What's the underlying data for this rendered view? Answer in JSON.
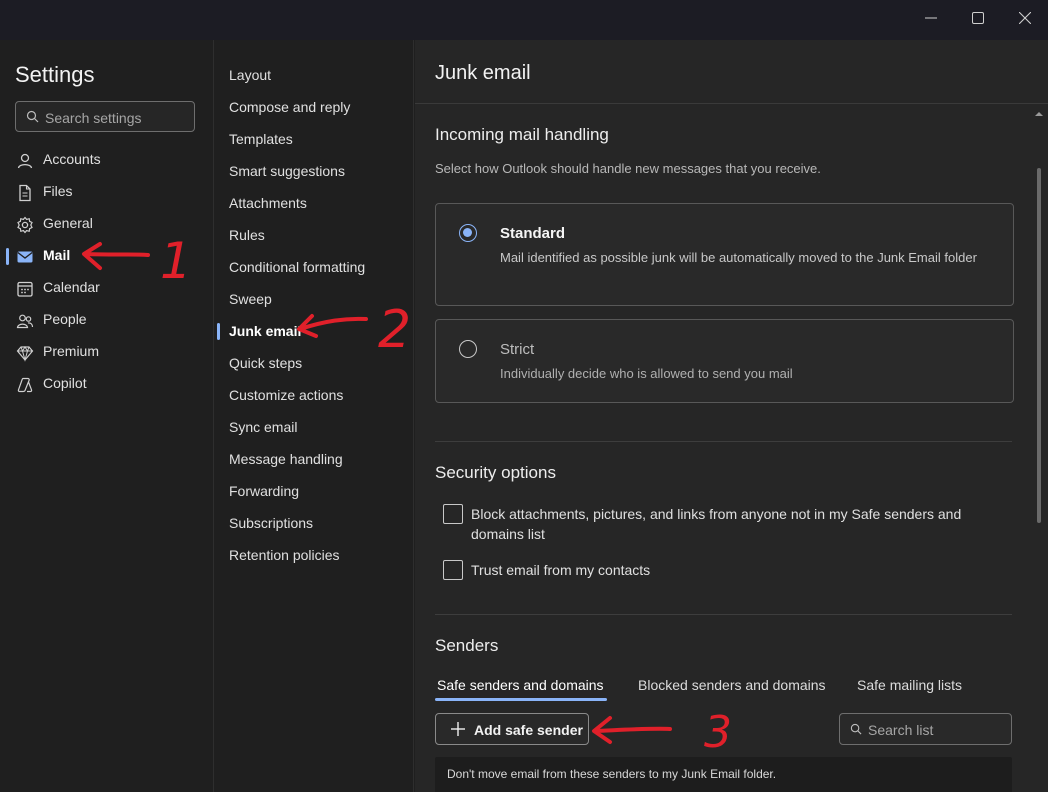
{
  "window_controls": {
    "minimize": "—",
    "maximize": "▢",
    "close": "✕"
  },
  "settings_nav": {
    "title": "Settings",
    "search_placeholder": "Search settings",
    "items": [
      {
        "label": "Accounts",
        "icon": "person-icon",
        "active": false
      },
      {
        "label": "Files",
        "icon": "file-icon",
        "active": false
      },
      {
        "label": "General",
        "icon": "gear-icon",
        "active": false
      },
      {
        "label": "Mail",
        "icon": "mail-icon",
        "active": true
      },
      {
        "label": "Calendar",
        "icon": "calendar-icon",
        "active": false
      },
      {
        "label": "People",
        "icon": "people-icon",
        "active": false
      },
      {
        "label": "Premium",
        "icon": "diamond-icon",
        "active": false
      },
      {
        "label": "Copilot",
        "icon": "copilot-icon",
        "active": false
      }
    ]
  },
  "mail_nav": {
    "items": [
      {
        "label": "Layout"
      },
      {
        "label": "Compose and reply"
      },
      {
        "label": "Templates"
      },
      {
        "label": "Smart suggestions"
      },
      {
        "label": "Attachments"
      },
      {
        "label": "Rules"
      },
      {
        "label": "Conditional formatting"
      },
      {
        "label": "Sweep"
      },
      {
        "label": "Junk email"
      },
      {
        "label": "Quick steps"
      },
      {
        "label": "Customize actions"
      },
      {
        "label": "Sync email"
      },
      {
        "label": "Message handling"
      },
      {
        "label": "Forwarding"
      },
      {
        "label": "Subscriptions"
      },
      {
        "label": "Retention policies"
      }
    ],
    "active_label": "Junk email"
  },
  "main": {
    "title": "Junk email",
    "incoming": {
      "heading": "Incoming mail handling",
      "description": "Select how Outlook should handle new messages that you receive.",
      "options": [
        {
          "title": "Standard",
          "description": "Mail identified as possible junk will be automatically moved to the Junk Email folder",
          "selected": true
        },
        {
          "title": "Strict",
          "description": "Individually decide who is allowed to send you mail",
          "selected": false
        }
      ]
    },
    "security": {
      "heading": "Security options",
      "checks": [
        {
          "label": "Block attachments, pictures, and links from anyone not in my Safe senders and domains list",
          "checked": false
        },
        {
          "label": "Trust email from my contacts",
          "checked": false
        }
      ]
    },
    "senders": {
      "heading": "Senders",
      "tabs": [
        {
          "label": "Safe senders and domains",
          "active": true
        },
        {
          "label": "Blocked senders and domains",
          "active": false
        },
        {
          "label": "Safe mailing lists",
          "active": false
        }
      ],
      "add_button": "Add safe sender",
      "search_placeholder": "Search list",
      "note": "Don't move email from these senders to my Junk Email folder."
    }
  },
  "annotations": {
    "step1": "1",
    "step2": "2",
    "step3": "3",
    "color": "#e0202a"
  },
  "colors": {
    "accent": "#8ab4f8",
    "background": "#1f1f1f",
    "panel": "#262626"
  }
}
